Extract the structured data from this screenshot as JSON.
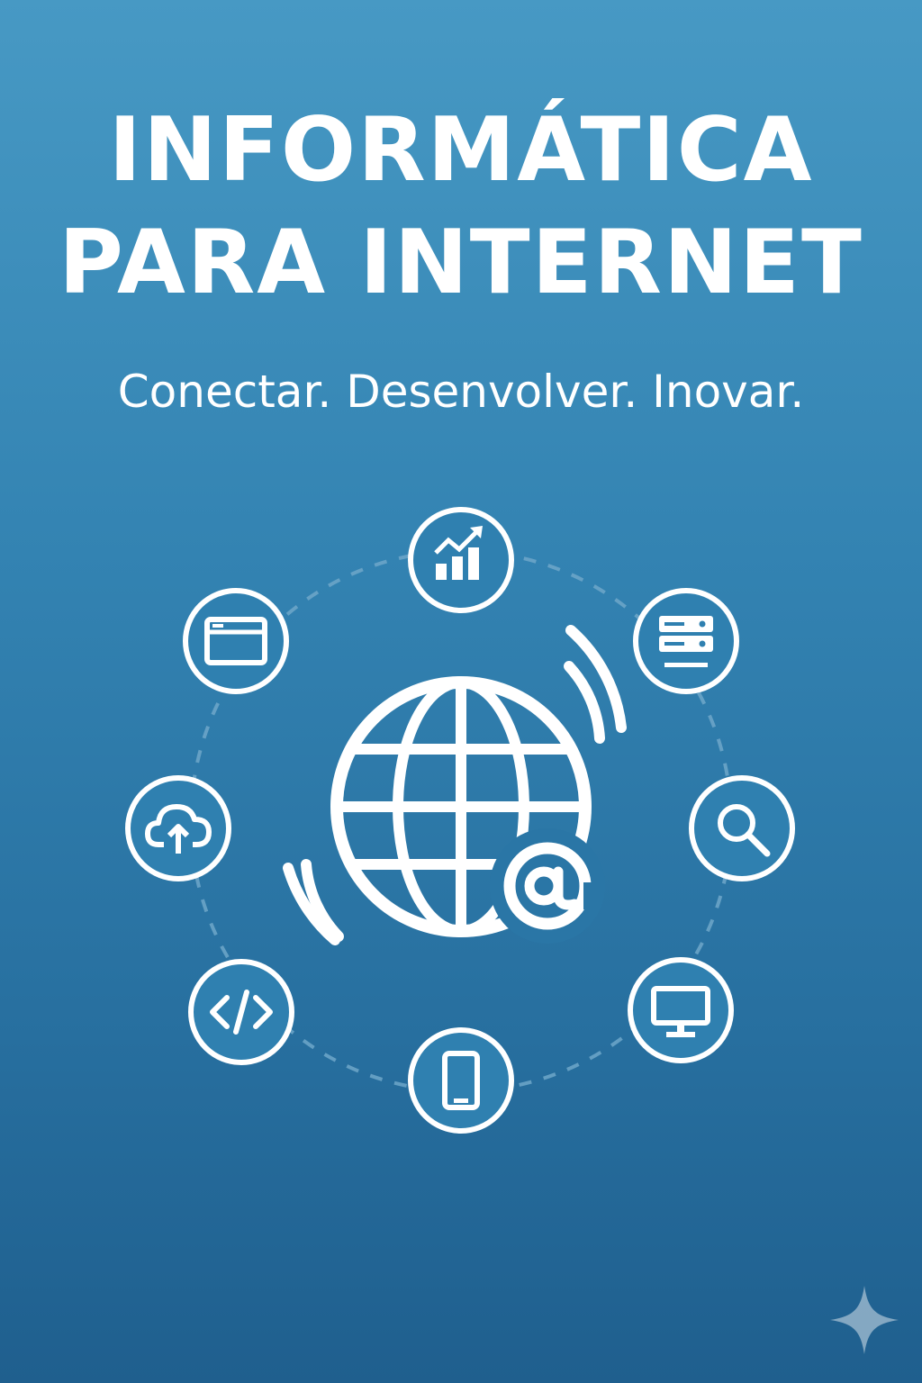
{
  "poster": {
    "title_line1": "INFORMÁTICA",
    "title_line2": "PARA INTERNET",
    "tagline": "Conectar. Desenvolver. Inovar."
  },
  "center_icon": "globe-at-icon",
  "satellite_icons": [
    "chart-growth-icon",
    "server-icon",
    "search-icon",
    "monitor-icon",
    "smartphone-icon",
    "code-icon",
    "cloud-upload-icon",
    "browser-window-icon"
  ],
  "colors": {
    "background_top": "#4799c4",
    "background_bottom": "#1f5f8e",
    "foreground": "#ffffff",
    "ring_dashes": "#6fa7c9"
  }
}
